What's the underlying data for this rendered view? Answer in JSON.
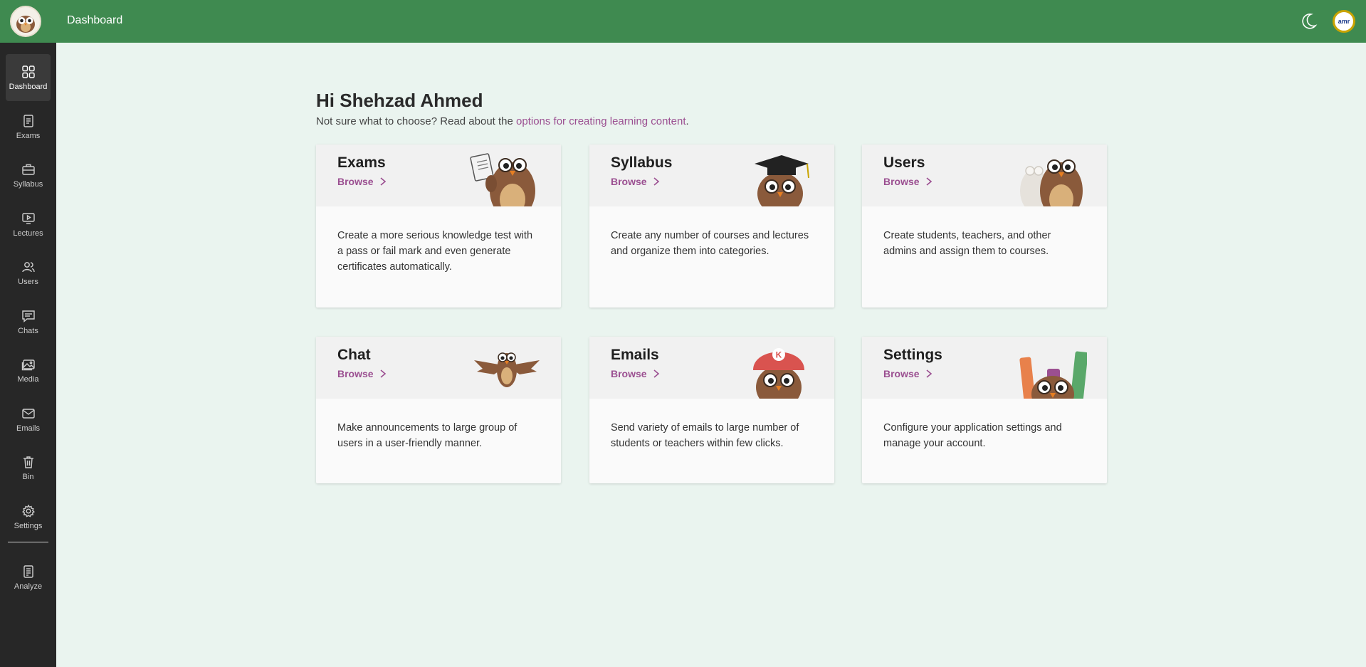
{
  "topbar": {
    "title": "Dashboard",
    "avatar_text": "amr"
  },
  "sidebar": {
    "items": [
      {
        "label": "Dashboard",
        "icon": "grid-icon"
      },
      {
        "label": "Exams",
        "icon": "document-icon"
      },
      {
        "label": "Syllabus",
        "icon": "briefcase-icon"
      },
      {
        "label": "Lectures",
        "icon": "video-icon"
      },
      {
        "label": "Users",
        "icon": "users-icon"
      },
      {
        "label": "Chats",
        "icon": "chat-icon"
      },
      {
        "label": "Media",
        "icon": "image-icon"
      },
      {
        "label": "Emails",
        "icon": "mail-icon"
      },
      {
        "label": "Bin",
        "icon": "trash-icon"
      },
      {
        "label": "Settings",
        "icon": "gear-icon"
      },
      {
        "label": "Analyze",
        "icon": "report-icon"
      }
    ]
  },
  "main": {
    "greeting": "Hi Shehzad Ahmed",
    "sub_prefix": "Not sure what to choose? Read about the ",
    "sub_link": "options for creating learning content",
    "sub_suffix": ".",
    "cards": [
      {
        "title": "Exams",
        "browse": "Browse",
        "text": "Create a more serious knowledge test with a pass or fail mark and even generate certificates automatically."
      },
      {
        "title": "Syllabus",
        "browse": "Browse",
        "text": "Create any number of courses and lectures and organize them into categories."
      },
      {
        "title": "Users",
        "browse": "Browse",
        "text": "Create students, teachers, and other admins and assign them to courses."
      },
      {
        "title": "Chat",
        "browse": "Browse",
        "text": "Make announcements to large group of users in a user-friendly manner."
      },
      {
        "title": "Emails",
        "browse": "Browse",
        "text": "Send variety of emails to large number of students or teachers within few clicks."
      },
      {
        "title": "Settings",
        "browse": "Browse",
        "text": "Configure your application settings and manage your account."
      }
    ],
    "email_badge": "K"
  },
  "colors": {
    "topbar": "#3f8a50",
    "sidebar": "#272727",
    "accent": "#9b4f91",
    "background": "#eaf4ef"
  }
}
